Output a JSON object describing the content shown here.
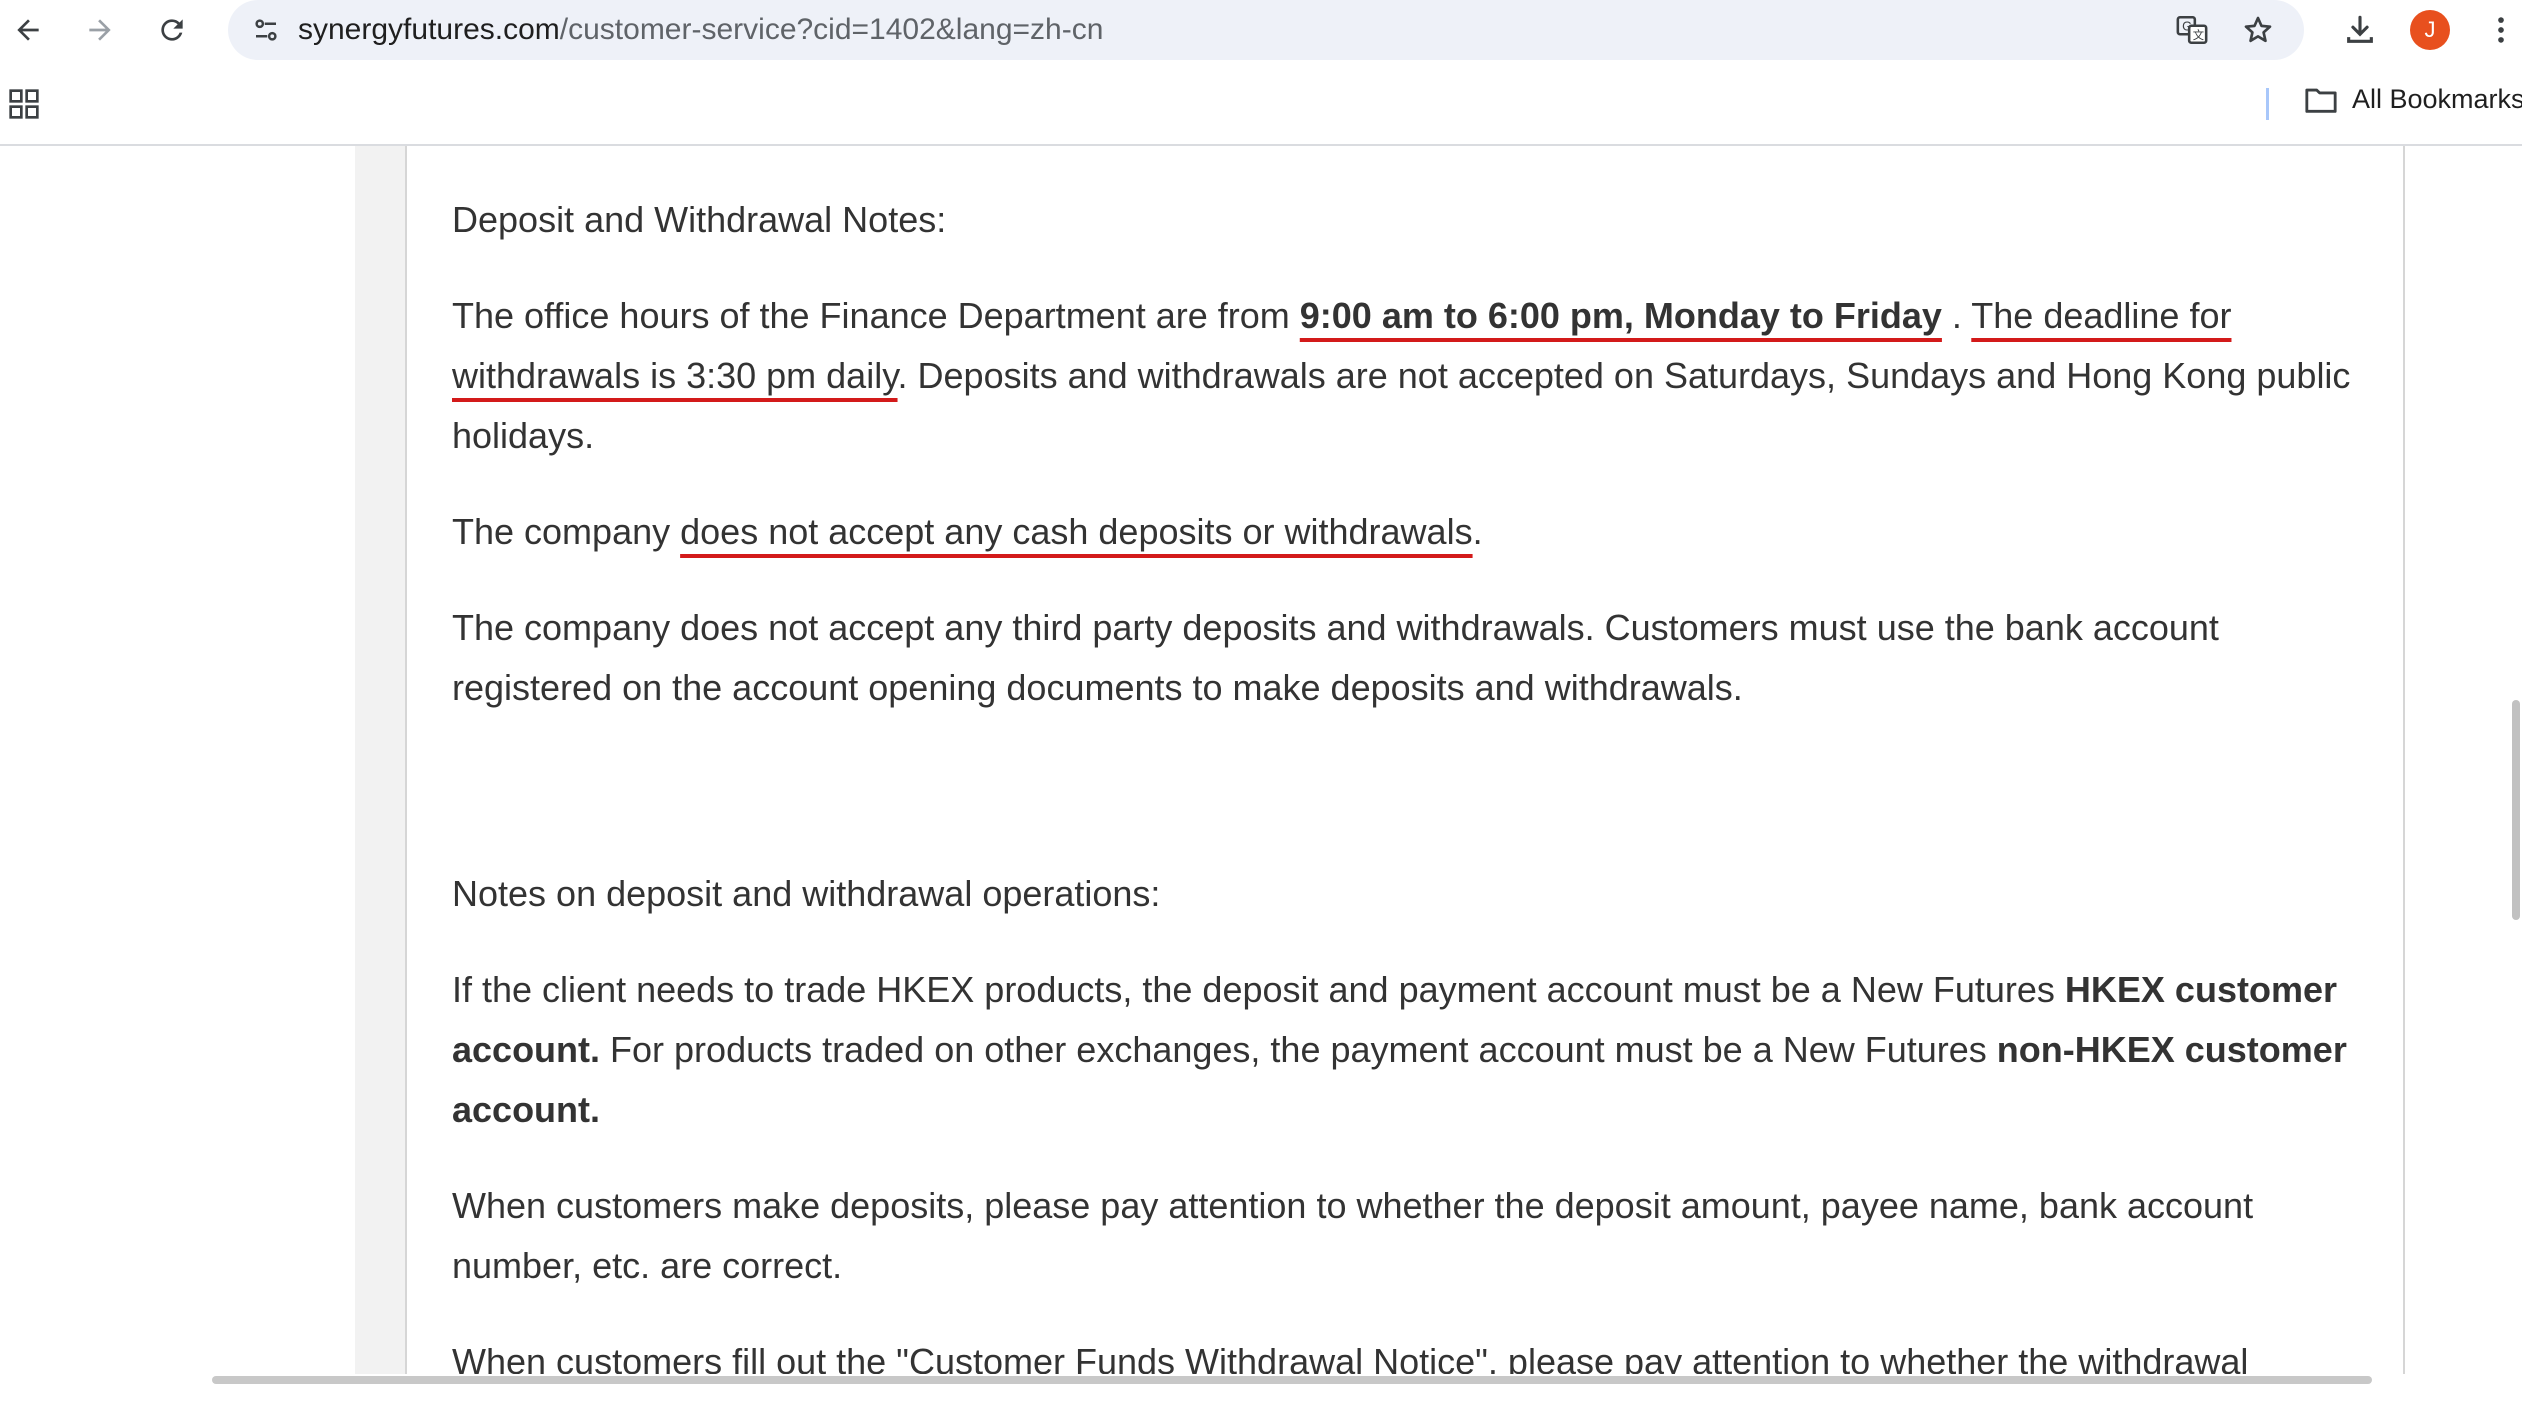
{
  "browser": {
    "url_host": "synergyfutures.com",
    "url_path": "/customer-service?cid=1402&lang=zh-cn",
    "profile_initial": "J",
    "all_bookmarks": "All Bookmarks",
    "icons": {
      "back": "back-arrow-icon",
      "forward": "forward-arrow-icon",
      "reload": "reload-icon",
      "site_info": "site-settings-icon",
      "translate": "translate-icon",
      "bookmark": "star-icon",
      "download": "download-icon",
      "apps": "apps-grid-icon",
      "folder": "folder-icon"
    },
    "colors": {
      "avatar": "#e8501e",
      "omnibox": "#eef1f8",
      "underline": "#d31a1a"
    }
  },
  "content": {
    "heading1": "Deposit and Withdrawal Notes:",
    "p1_a": "The office hours of the Finance Department are from ",
    "p1_bold": "9:00 am to 6:00 pm, Monday to Friday",
    "p1_b": " . ",
    "p1_ul": "The deadline for withdrawals is 3:30 pm daily",
    "p1_c": ". Deposits and withdrawals are not accepted on Saturdays, Sundays and Hong Kong public holidays.",
    "p2_a": "The company ",
    "p2_ul": "does not accept any cash deposits or withdrawals",
    "p2_b": ".",
    "p3": "The company does not accept any third party deposits and withdrawals. Customers must use the bank account registered on the account opening documents to make deposits and withdrawals.",
    "heading2": "Notes on deposit and withdrawal operations:",
    "p4_a": "If the client needs to trade HKEX products, the deposit and payment account must be a New Futures ",
    "p4_bold1": "HKEX customer account.",
    "p4_b": " For products traded on other exchanges, the payment account must be a New Futures ",
    "p4_bold2": "non-HKEX customer account.",
    "p5": "When customers make deposits, please pay attention to whether the deposit amount, payee name, bank account number, etc. are correct.",
    "p6": "When customers fill out the \"Customer Funds Withdrawal Notice\", please pay attention to whether the withdrawal"
  }
}
